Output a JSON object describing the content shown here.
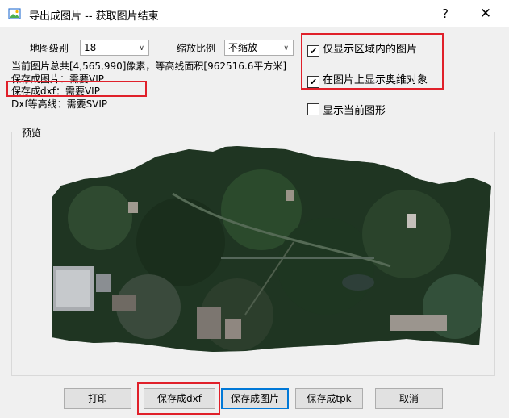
{
  "window": {
    "title": "导出成图片 -- 获取图片结束",
    "help": "?",
    "close": "✕"
  },
  "settings": {
    "level_label": "地图级别",
    "level_value": "18",
    "scale_label": "缩放比例",
    "scale_value": "不缩放"
  },
  "info": {
    "line1": "当前图片总共[4,565,990]像素，等高线面积[962516.6平方米]",
    "line2": "保存成图片：需要VIP",
    "line3": "保存成dxf：需要VIP",
    "line4": "Dxf等高线：需要SVIP"
  },
  "options": {
    "only_in_region": {
      "label": "仅显示区域内的图片",
      "checked": true
    },
    "show_objects": {
      "label": "在图片上显示奥维对象",
      "checked": true
    },
    "show_current": {
      "label": "显示当前图形",
      "checked": false
    }
  },
  "preview": {
    "title": "预览"
  },
  "buttons": {
    "print": "打印",
    "save_dxf": "保存成dxf",
    "save_image": "保存成图片",
    "save_tpk": "保存成tpk",
    "cancel": "取消"
  },
  "colors": {
    "highlight": "#e0202a",
    "focus": "#0078d7"
  }
}
